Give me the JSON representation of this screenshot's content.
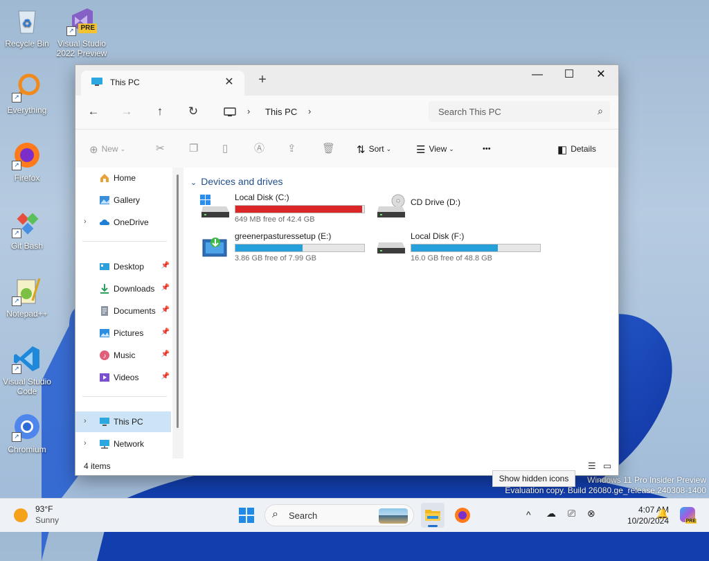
{
  "desktop": {
    "icons": [
      {
        "label": "Recycle Bin"
      },
      {
        "label": "Visual Studio 2022 Preview",
        "badge": "PRE"
      },
      {
        "label": "Everything"
      },
      {
        "label": "Firefox"
      },
      {
        "label": "Git Bash"
      },
      {
        "label": "Notepad++"
      },
      {
        "label": "Visual Studio Code"
      },
      {
        "label": "Chromium"
      }
    ],
    "watermark_line1": "Windows 11 Pro Insider Preview",
    "watermark_line2": "Evaluation copy. Build 26080.ge_release.240308-1400"
  },
  "window": {
    "tab_title": "This PC",
    "tab_close": "✕",
    "new_tab": "+",
    "controls": {
      "minimize": "—",
      "maximize": "☐",
      "close": "✕"
    },
    "nav": {
      "back": "←",
      "forward": "→",
      "up": "↑",
      "refresh": "↻"
    },
    "address": {
      "crumb": "This PC",
      "chevron": "›"
    },
    "search_placeholder": "Search This PC",
    "commands": {
      "new": "New",
      "sort": "Sort",
      "view": "View",
      "more": "•••",
      "details": "Details"
    },
    "sidebar": {
      "items": [
        {
          "label": "Home"
        },
        {
          "label": "Gallery"
        },
        {
          "label": "OneDrive"
        },
        {
          "label": "Desktop"
        },
        {
          "label": "Downloads"
        },
        {
          "label": "Documents"
        },
        {
          "label": "Pictures"
        },
        {
          "label": "Music"
        },
        {
          "label": "Videos"
        },
        {
          "label": "This PC"
        },
        {
          "label": "Network"
        }
      ]
    },
    "group_title": "Devices and drives",
    "drives": [
      {
        "name": "Local Disk (C:)",
        "free": "649 MB free of 42.4 GB",
        "used_fraction": 0.985,
        "bar_color": "#da2626"
      },
      {
        "name": "CD Drive (D:)"
      },
      {
        "name": "greenerpasturessetup (E:)",
        "free": "3.86 GB free of 7.99 GB",
        "used_fraction": 0.52,
        "bar_color": "#26a0da"
      },
      {
        "name": "Local Disk (F:)",
        "free": "16.0 GB free of 48.8 GB",
        "used_fraction": 0.67,
        "bar_color": "#26a0da"
      }
    ],
    "status_count": "4 items"
  },
  "tooltip": "Show hidden icons",
  "taskbar": {
    "weather_temp": "93°F",
    "weather_desc": "Sunny",
    "search_label": "Search",
    "time": "4:07 AM",
    "date": "10/20/2024",
    "tray_chevron": "^"
  }
}
